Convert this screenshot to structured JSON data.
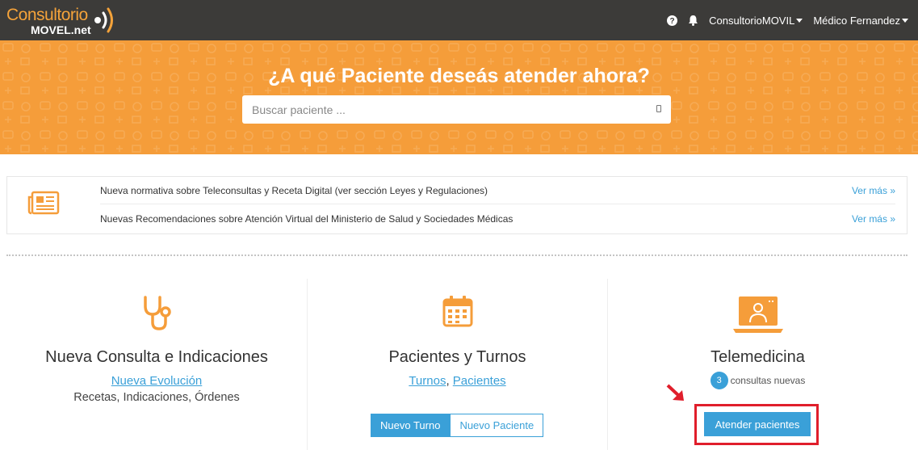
{
  "brand": {
    "name_line1": "Consultorio",
    "name_line2": "MOVEL.net",
    "logo_color": "#f5a33a"
  },
  "nav": {
    "help_icon": "question-circle-icon",
    "notifications_icon": "bell-icon",
    "account_label": "ConsultorioMOVIL",
    "user_label": "Médico Fernandez"
  },
  "hero": {
    "title": "¿A qué Paciente deseás atender ahora?",
    "search_placeholder": "Buscar paciente ...",
    "background_color": "#f59d3a"
  },
  "news": {
    "icon": "newspaper-icon",
    "items": [
      {
        "text": "Nueva normativa sobre Teleconsultas y Receta Digital (ver sección Leyes y Regulaciones)",
        "link": "Ver más »"
      },
      {
        "text": "Nuevas Recomendaciones sobre Atención Virtual del Ministerio de Salud y Sociedades Médicas",
        "link": "Ver más »"
      }
    ]
  },
  "columns": {
    "consulta": {
      "icon": "stethoscope-icon",
      "title": "Nueva Consulta e Indicaciones",
      "link": "Nueva Evolución",
      "subtitle": "Recetas, Indicaciones, Órdenes"
    },
    "turnos": {
      "icon": "calendar-icon",
      "title": "Pacientes y Turnos",
      "link1": "Turnos",
      "separator": ",",
      "link2": "Pacientes",
      "btn_primary": "Nuevo Turno",
      "btn_secondary": "Nuevo Paciente"
    },
    "telemedicina": {
      "icon": "laptop-doctor-icon",
      "title": "Telemedicina",
      "badge_count": "3",
      "badge_text": "consultas nuevas",
      "button": "Atender pacientes",
      "highlight_color": "#e01e2b"
    }
  },
  "colors": {
    "primary_blue": "#3aa0d8",
    "orange": "#f59d3a",
    "topbar": "#3c3b39"
  }
}
